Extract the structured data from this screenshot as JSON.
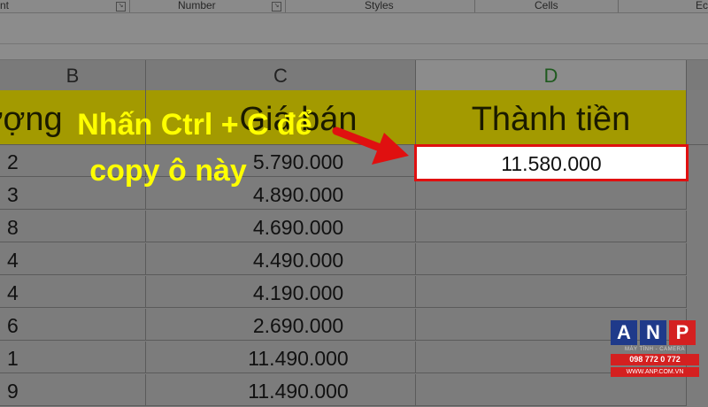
{
  "ribbon": {
    "groups": [
      {
        "label": "nt"
      },
      {
        "label": "Number"
      },
      {
        "label": "Styles"
      },
      {
        "label": "Cells"
      },
      {
        "label": "Ec"
      }
    ]
  },
  "columns": {
    "b": "B",
    "c": "C",
    "d": "D"
  },
  "header_row": {
    "b": "ượng",
    "c": "Giá bán",
    "d": "Thành tiền"
  },
  "rows": [
    {
      "b": "2",
      "c": "5.790.000",
      "d": "11.580.000"
    },
    {
      "b": "3",
      "c": "4.890.000",
      "d": ""
    },
    {
      "b": "8",
      "c": "4.690.000",
      "d": ""
    },
    {
      "b": "4",
      "c": "4.490.000",
      "d": ""
    },
    {
      "b": "4",
      "c": "4.190.000",
      "d": ""
    },
    {
      "b": "6",
      "c": "2.690.000",
      "d": ""
    },
    {
      "b": "1",
      "c": "11.490.000",
      "d": ""
    },
    {
      "b": "9",
      "c": "11.490.000",
      "d": ""
    }
  ],
  "annotation": {
    "line1": "Nhấn Ctrl + C để",
    "line2": "copy ô này"
  },
  "logo": {
    "letters": [
      "A",
      "N",
      "P"
    ],
    "tagline": "MÁY TÍNH - CAMERA",
    "phone": "098 772 0 772",
    "website": "WWW.ANP.COM.VN"
  },
  "colors": {
    "header_fill": "#a39a00",
    "annotation_text": "#ffff00",
    "selection_border": "#e01010",
    "arrow": "#e01010"
  }
}
